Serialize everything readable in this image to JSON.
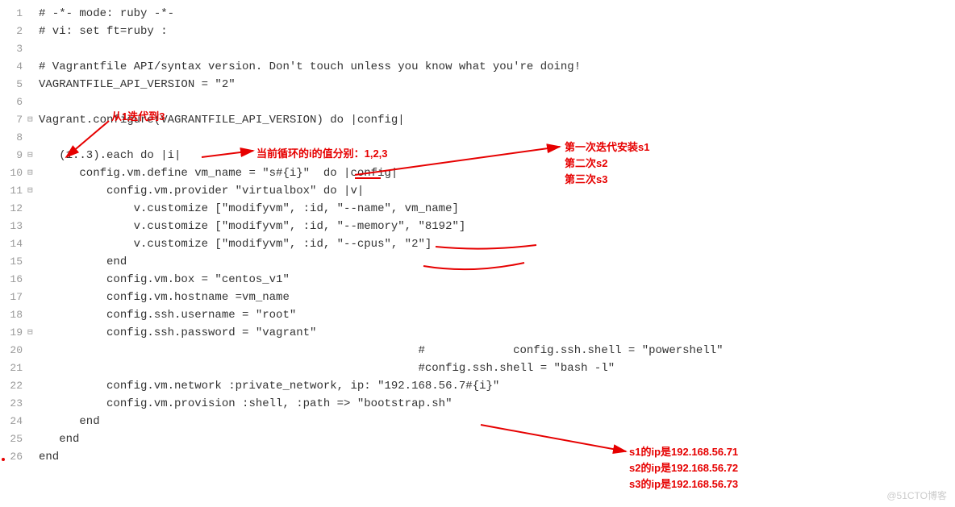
{
  "lines": [
    {
      "n": "1",
      "fold": "",
      "code": "# -*- mode: ruby -*-"
    },
    {
      "n": "2",
      "fold": "",
      "code": "# vi: set ft=ruby :"
    },
    {
      "n": "3",
      "fold": "",
      "code": ""
    },
    {
      "n": "4",
      "fold": "",
      "code": "# Vagrantfile API/syntax version. Don't touch unless you know what you're doing!"
    },
    {
      "n": "5",
      "fold": "",
      "code": "VAGRANTFILE_API_VERSION = \"2\""
    },
    {
      "n": "6",
      "fold": "",
      "code": ""
    },
    {
      "n": "7",
      "fold": "⊟",
      "code": "Vagrant.configure(VAGRANTFILE_API_VERSION) do |config|"
    },
    {
      "n": "8",
      "fold": "",
      "code": ""
    },
    {
      "n": "9",
      "fold": "⊟",
      "code": "   (1..3).each do |i|"
    },
    {
      "n": "10",
      "fold": "⊟",
      "code": "      config.vm.define vm_name = \"s#{i}\"  do |config|"
    },
    {
      "n": "11",
      "fold": "⊟",
      "code": "          config.vm.provider \"virtualbox\" do |v|"
    },
    {
      "n": "12",
      "fold": "",
      "code": "              v.customize [\"modifyvm\", :id, \"--name\", vm_name]"
    },
    {
      "n": "13",
      "fold": "",
      "code": "              v.customize [\"modifyvm\", :id, \"--memory\", \"8192\"]"
    },
    {
      "n": "14",
      "fold": "",
      "code": "              v.customize [\"modifyvm\", :id, \"--cpus\", \"2\"]"
    },
    {
      "n": "15",
      "fold": "",
      "code": "          end"
    },
    {
      "n": "16",
      "fold": "",
      "code": "          config.vm.box = \"centos_v1\""
    },
    {
      "n": "17",
      "fold": "",
      "code": "          config.vm.hostname =vm_name"
    },
    {
      "n": "18",
      "fold": "",
      "code": "          config.ssh.username = \"root\""
    },
    {
      "n": "19",
      "fold": "⊟",
      "code": "          config.ssh.password = \"vagrant\""
    },
    {
      "n": "20",
      "fold": "",
      "code": "                                                        #             config.ssh.shell = \"powershell\""
    },
    {
      "n": "21",
      "fold": "",
      "code": "                                                        #config.ssh.shell = \"bash -l\""
    },
    {
      "n": "22",
      "fold": "",
      "code": "          config.vm.network :private_network, ip: \"192.168.56.7#{i}\""
    },
    {
      "n": "23",
      "fold": "",
      "code": "          config.vm.provision :shell, :path => \"bootstrap.sh\""
    },
    {
      "n": "24",
      "fold": "",
      "code": "      end"
    },
    {
      "n": "25",
      "fold": "",
      "code": "   end"
    },
    {
      "n": "26",
      "fold": "",
      "code": "end"
    }
  ],
  "annotations": {
    "iter": "从1迭代到3",
    "loop": "当前循环的i的值分别：1,2,3",
    "install1": "第一次迭代安装s1",
    "install2": "第二次s2",
    "install3": "第三次s3",
    "ip1": "s1的ip是192.168.56.71",
    "ip2": "s2的ip是192.168.56.72",
    "ip3": "s3的ip是192.168.56.73"
  },
  "watermark": "@51CTO博客"
}
